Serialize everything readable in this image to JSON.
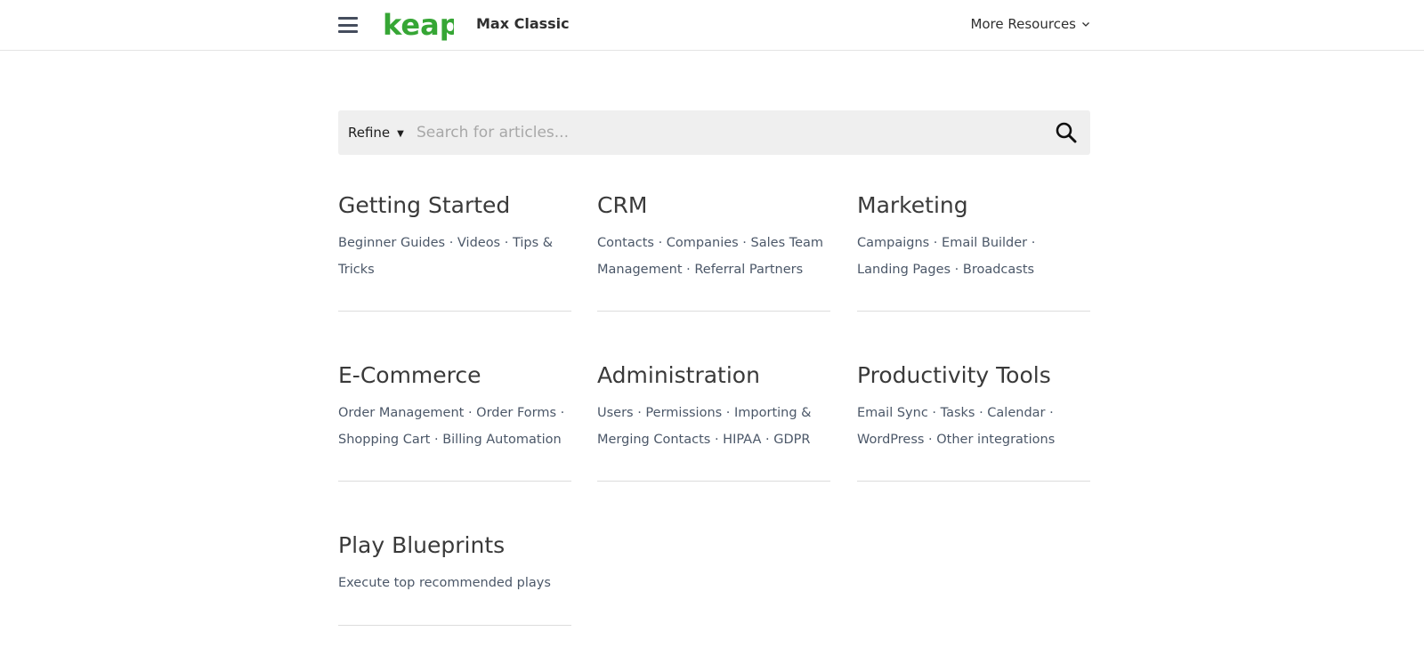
{
  "header": {
    "logo_text": "keap",
    "product_name": "Max Classic",
    "more_resources_label": "More Resources"
  },
  "search": {
    "refine_label": "Refine",
    "placeholder": "Search for articles..."
  },
  "categories": [
    {
      "title": "Getting Started",
      "description": "Beginner Guides · Videos · Tips & Tricks"
    },
    {
      "title": "CRM",
      "description": "Contacts · Companies · Sales Team Management · Referral Partners"
    },
    {
      "title": "Marketing",
      "description": "Campaigns · Email Builder · Landing Pages · Broadcasts"
    },
    {
      "title": "E-Commerce",
      "description": "Order Management · Order Forms · Shopping Cart · Billing Automation"
    },
    {
      "title": "Administration",
      "description": "Users · Permissions · Importing & Merging Contacts · HIPAA · GDPR"
    },
    {
      "title": "Productivity Tools",
      "description": "Email Sync · Tasks · Calendar · WordPress · Other integrations"
    },
    {
      "title": "Play Blueprints",
      "description": "Execute top recommended plays"
    }
  ],
  "colors": {
    "brand_green": "#36a635",
    "search_bg": "#efefef",
    "divider": "#dcdcdc"
  }
}
